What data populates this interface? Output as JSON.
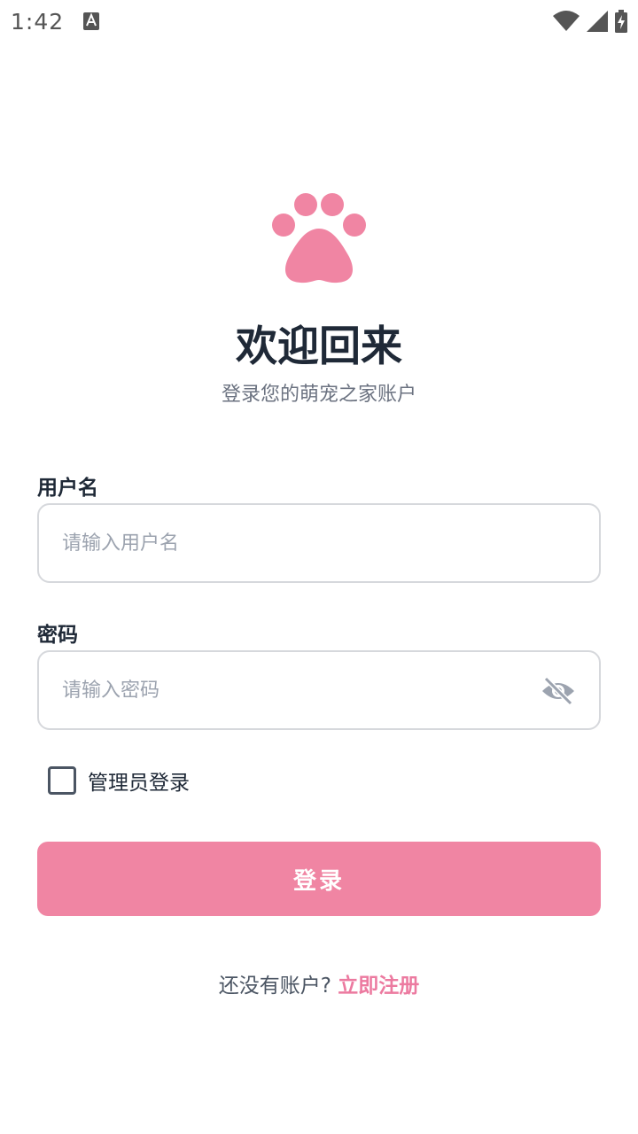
{
  "status_bar": {
    "time": "1:42",
    "icons": [
      "keyboard-a-icon",
      "wifi-icon",
      "cell-signal-icon",
      "battery-charging-icon"
    ]
  },
  "header": {
    "logo_icon": "paw-icon",
    "title": "欢迎回来",
    "subtitle": "登录您的萌宠之家账户"
  },
  "form": {
    "username": {
      "label": "用户名",
      "placeholder": "请输入用户名",
      "value": ""
    },
    "password": {
      "label": "密码",
      "placeholder": "请输入密码",
      "value": "",
      "toggle_icon": "eye-off-icon"
    },
    "admin_checkbox": {
      "label": "管理员登录",
      "checked": false
    },
    "submit_label": "登录"
  },
  "footer": {
    "prompt": "还没有账户?",
    "register_link": "立即注册"
  },
  "colors": {
    "accent": "#f085a3",
    "link": "#ec7aa0",
    "title": "#1f2937",
    "muted": "#6b7280"
  }
}
